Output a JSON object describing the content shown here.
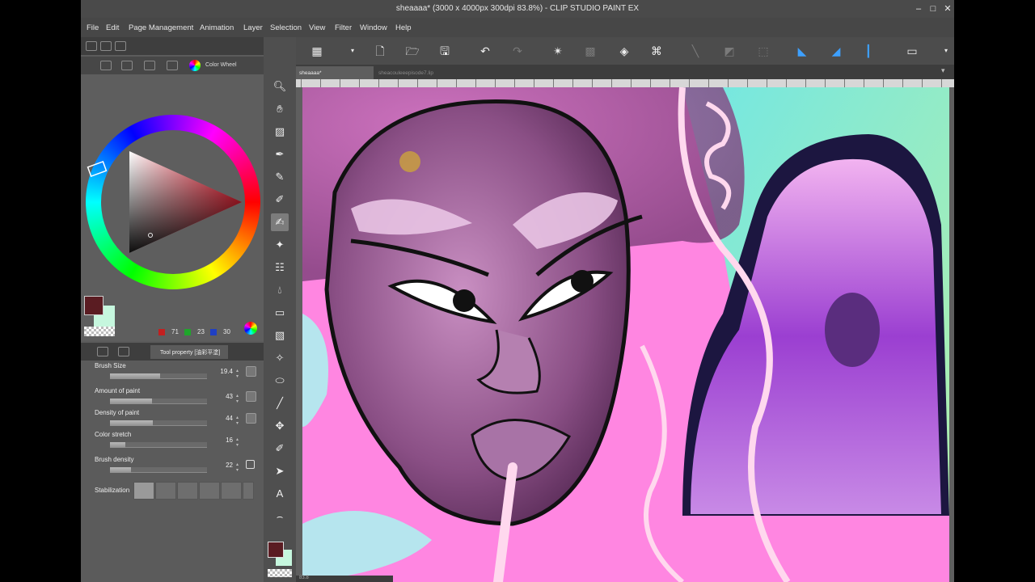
{
  "window": {
    "title": "sheaaaa* (3000 x 4000px 300dpi 83.8%) - CLIP STUDIO PAINT EX"
  },
  "menu": [
    "File",
    "Edit",
    "Page Management",
    "Animation",
    "Layer",
    "Selection",
    "View",
    "Filter",
    "Window",
    "Help"
  ],
  "color_panel": {
    "tab_label": "Color Wheel",
    "main_color": "#5a1c22",
    "sub_color": "#c6f7de",
    "rgb": {
      "r": "71",
      "g": "23",
      "b": "30"
    }
  },
  "tool_property": {
    "tab_label": "Tool property [油彩平塗]",
    "items": [
      {
        "label": "Brush Size",
        "value": "19.4",
        "fill": 0.52
      },
      {
        "label": "Amount of paint",
        "value": "43",
        "fill": 0.43
      },
      {
        "label": "Density of paint",
        "value": "44",
        "fill": 0.44
      },
      {
        "label": "Color stretch",
        "value": "16",
        "fill": 0.16
      },
      {
        "label": "Brush density",
        "value": "22",
        "fill": 0.22
      }
    ],
    "stabilization_label": "Stabilization"
  },
  "documents": {
    "tabs": [
      {
        "label": "sheaaaa*"
      },
      {
        "label": "sheacouleeepisode7.lip"
      }
    ]
  },
  "status": {
    "zoom": "83.8"
  },
  "colors": {
    "accent_blue": "#3da0ff",
    "canvas_pink": "#ff86e1"
  }
}
